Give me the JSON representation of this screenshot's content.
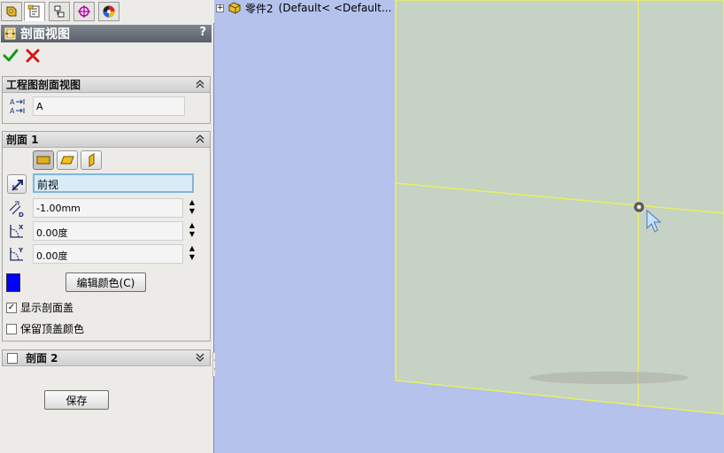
{
  "property_manager": {
    "title": "剖面视图",
    "help": "?",
    "tabs": [
      {
        "name": "feature-manager-tab"
      },
      {
        "name": "property-manager-tab"
      },
      {
        "name": "configuration-manager-tab"
      },
      {
        "name": "dimxpert-manager-tab"
      },
      {
        "name": "display-manager-tab"
      }
    ],
    "ok_icon": "check-icon",
    "cancel_icon": "x-icon",
    "drawing_section": {
      "header": "工程图剖面视图",
      "label_value": "A"
    },
    "section1": {
      "header": "剖面 1",
      "plane": "前视",
      "offset": "-1.00mm",
      "rotate_x": "0.00度",
      "rotate_y": "0.00度",
      "edit_color_label": "编辑颜色(C)",
      "cap_color": "#0000ff",
      "show_cap_label": "显示剖面盖",
      "show_cap_checked": true,
      "keep_cap_color_label": "保留顶盖颜色",
      "keep_cap_color_checked": false
    },
    "section2": {
      "header": "剖面 2",
      "checked": false
    },
    "save_label": "保存"
  },
  "tree": {
    "part_name": "零件2",
    "config": "(Default<  <Default..."
  },
  "colors": {
    "viewport_bg": "#b4c2ec",
    "plane_fill": "#c6d2c4",
    "plane_edge": "#e8f060",
    "accent_blue": "#0000ff"
  }
}
